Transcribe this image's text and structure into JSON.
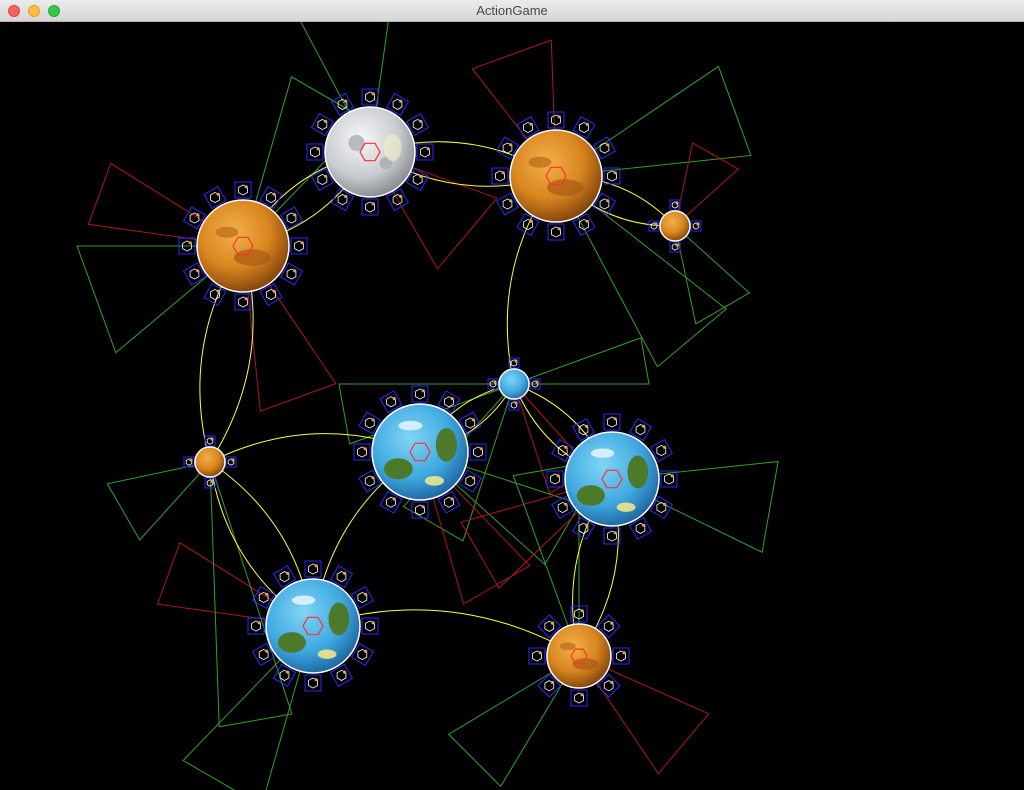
{
  "window": {
    "title": "ActionGame"
  },
  "colors": {
    "background": "#000000",
    "link_curve": "#ffff33",
    "sensor_green": "#33a02c",
    "sensor_red": "#b01515",
    "slot_outline": "#2a2aff",
    "core_hex": "#ff3030",
    "orbit_ring": "#ffffff",
    "slot_dot": "#e0a060"
  },
  "planets": [
    {
      "id": "moon-top",
      "kind": "moon"
    },
    {
      "id": "desert-top-right",
      "kind": "desert"
    },
    {
      "id": "desert-left",
      "kind": "desert"
    },
    {
      "id": "desert-small-right",
      "kind": "desert"
    },
    {
      "id": "ocean-tiny-center",
      "kind": "ocean"
    },
    {
      "id": "desert-small-left",
      "kind": "desert"
    },
    {
      "id": "ocean-center",
      "kind": "ocean"
    },
    {
      "id": "ocean-right",
      "kind": "ocean"
    },
    {
      "id": "ocean-bottom-left",
      "kind": "ocean"
    },
    {
      "id": "desert-bottom-right",
      "kind": "desert"
    }
  ]
}
